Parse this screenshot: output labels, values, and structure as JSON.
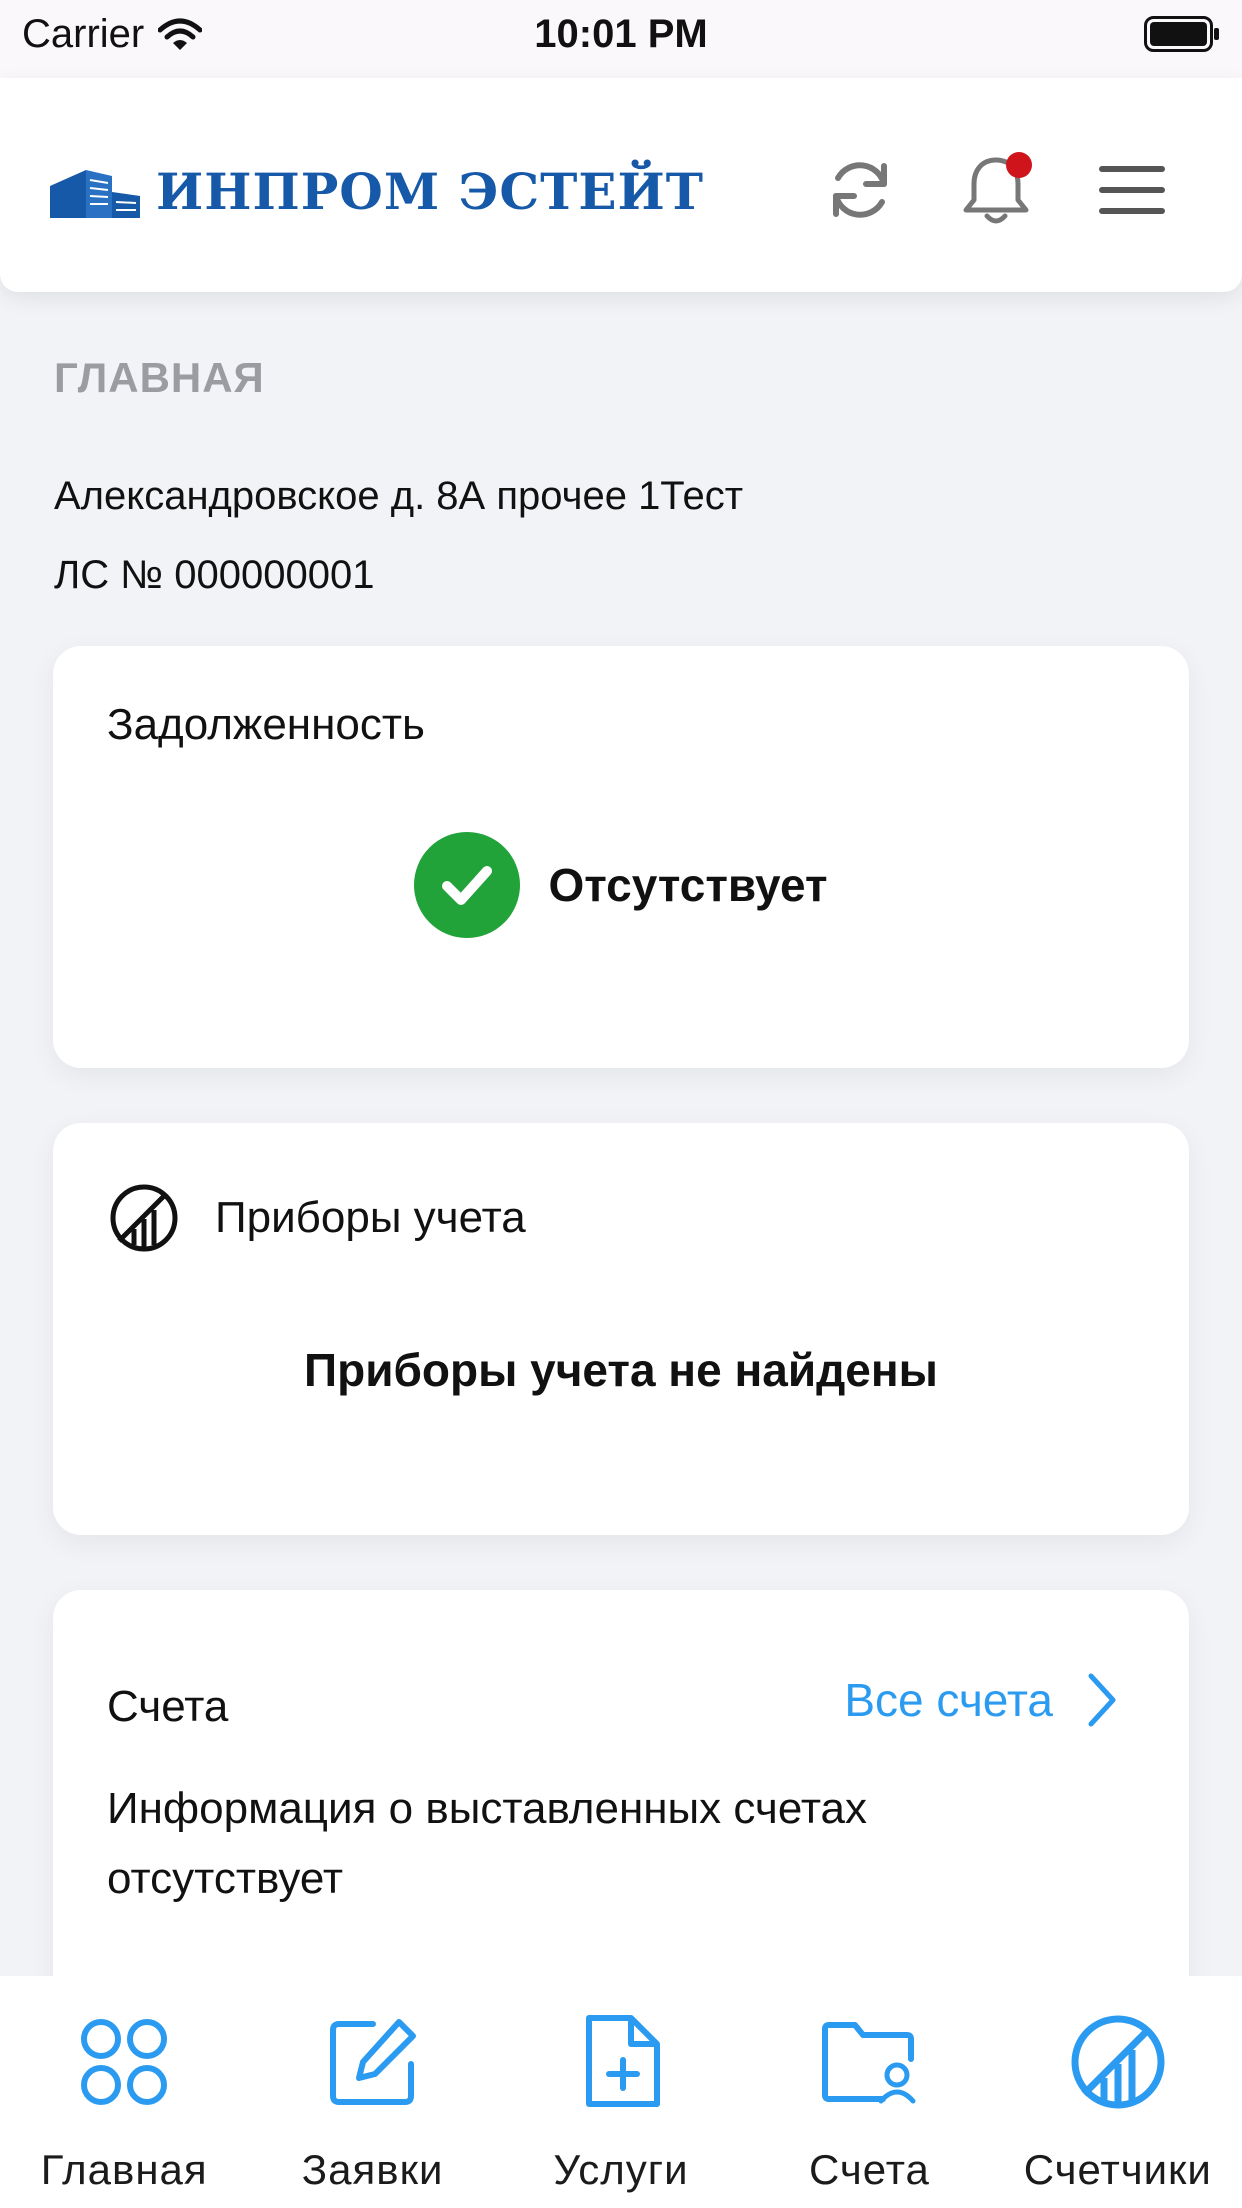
{
  "status_bar": {
    "carrier": "Carrier",
    "time": "10:01 PM"
  },
  "header": {
    "logo_text": "ИНПРОМ ЭСТЕЙТ",
    "brand_color": "#1559a8",
    "icons": [
      "refresh-icon",
      "bell-icon",
      "menu-icon"
    ],
    "has_unread_notifications": true
  },
  "page": {
    "title": "ГЛАВНАЯ",
    "address": "Александровское д. 8А прочее 1Тест",
    "account": "ЛС № 000000001"
  },
  "debt_card": {
    "title": "Задолженность",
    "status": "Отсутствует",
    "status_color": "#22a33a"
  },
  "meters_card": {
    "title": "Приборы учета",
    "empty_text": "Приборы учета не найдены"
  },
  "bills_card": {
    "title": "Счета",
    "link_label": "Все счета",
    "empty_text": "Информация о выставленных счетах отсутствует",
    "link_color": "#2a9bf0"
  },
  "tab_bar": {
    "accent_color": "#2a9bf0",
    "items": [
      {
        "label": "Главная",
        "icon": "grid-icon"
      },
      {
        "label": "Заявки",
        "icon": "edit-icon"
      },
      {
        "label": "Услуги",
        "icon": "file-add-icon"
      },
      {
        "label": "Счета",
        "icon": "folder-user-icon"
      },
      {
        "label": "Счетчики",
        "icon": "meter-icon"
      }
    ]
  }
}
